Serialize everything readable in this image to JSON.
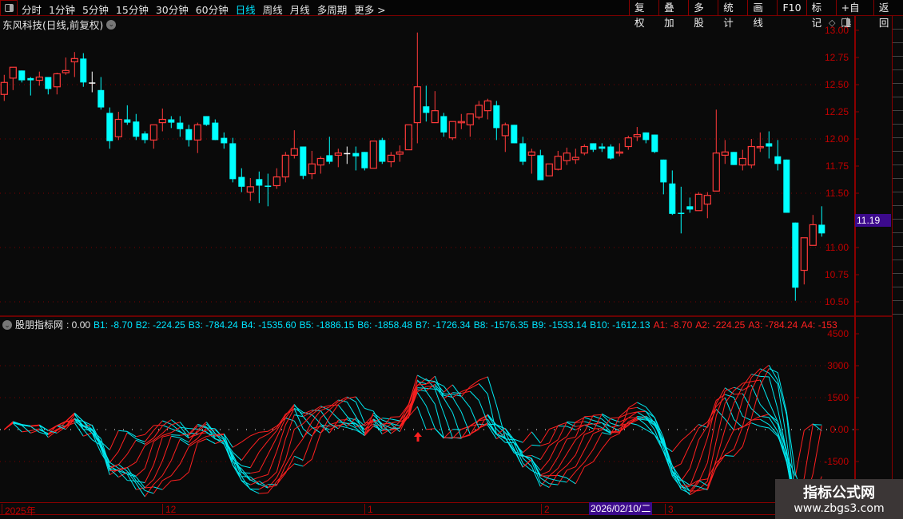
{
  "toolbar": {
    "tabs": [
      "分时",
      "1分钟",
      "5分钟",
      "15分钟",
      "30分钟",
      "60分钟",
      "日线",
      "周线",
      "月线",
      "多周期",
      "更多 >"
    ],
    "active_tab": "日线",
    "buttons": [
      "复权",
      "叠加",
      "多股",
      "统计",
      "画线",
      "F10",
      "标记",
      "+自选",
      "返回"
    ]
  },
  "chart_title": "东风科技(日线,前复权)",
  "colors": {
    "up": "#ff3a3a",
    "down": "#00ffff",
    "doji": "#ffffff",
    "axis": "#c00000",
    "highlight": "#3c0a8c",
    "background": "#0a0a0a"
  },
  "icons": [
    "layout-toggle-icon",
    "chevron-down-icon",
    "diamond-icon",
    "up-arrow-signal-icon"
  ],
  "price_axis": {
    "ticks": [
      "13.00",
      "12.75",
      "12.50",
      "12.25",
      "12.00",
      "11.75",
      "11.50",
      "11.00",
      "10.75",
      "10.50"
    ],
    "ylim": [
      10.45,
      13.05
    ],
    "current_price": "11.19"
  },
  "indicator": {
    "name": "股朋指标网",
    "value": ": 0.00",
    "b_values": [
      "B1: -8.70",
      "B2: -224.25",
      "B3: -784.24",
      "B4: -1535.60",
      "B5: -1886.15",
      "B6: -1858.48",
      "B7: -1726.34",
      "B8: -1576.35",
      "B9: -1533.14",
      "B10: -1612.13"
    ],
    "a_values": [
      "A1: -8.70",
      "A2: -224.25",
      "A3: -784.24",
      "A4: -153"
    ],
    "axis_ticks": [
      "4500",
      "3000",
      "1500",
      "0.00",
      "-1500"
    ],
    "ylim": [
      -2400,
      4700
    ]
  },
  "time_axis": {
    "labels": [
      "2025年",
      "12",
      "1",
      "2",
      "3"
    ],
    "cursor_date": "2026/02/10/二"
  },
  "watermark": {
    "line1": "指标公式网",
    "line2": "www.zbgs3.com"
  },
  "chart_data": {
    "type": "candlestick",
    "fields": [
      "open",
      "high",
      "low",
      "close"
    ],
    "ohlc": [
      [
        12.41,
        12.59,
        12.35,
        12.52
      ],
      [
        12.56,
        12.66,
        12.45,
        12.66
      ],
      [
        12.63,
        12.63,
        12.52,
        12.54
      ],
      [
        12.56,
        12.57,
        12.4,
        12.54
      ],
      [
        12.54,
        12.62,
        12.49,
        12.57
      ],
      [
        12.57,
        12.57,
        12.41,
        12.46
      ],
      [
        12.48,
        12.61,
        12.41,
        12.6
      ],
      [
        12.61,
        12.75,
        12.59,
        12.63
      ],
      [
        12.71,
        12.8,
        12.57,
        12.74
      ],
      [
        12.74,
        12.79,
        12.48,
        12.52
      ],
      [
        12.52,
        12.62,
        12.43,
        12.52
      ],
      [
        12.45,
        12.57,
        12.27,
        12.29
      ],
      [
        12.24,
        12.29,
        11.91,
        11.98
      ],
      [
        12.02,
        12.25,
        11.99,
        12.18
      ],
      [
        12.18,
        12.31,
        12.13,
        12.15
      ],
      [
        12.16,
        12.23,
        11.99,
        12.02
      ],
      [
        12.05,
        12.07,
        11.96,
        11.99
      ],
      [
        11.99,
        12.13,
        11.91,
        12.13
      ],
      [
        12.15,
        12.28,
        12.07,
        12.18
      ],
      [
        12.18,
        12.21,
        12.1,
        12.15
      ],
      [
        12.15,
        12.21,
        12.02,
        12.09
      ],
      [
        12.09,
        12.13,
        11.93,
        11.99
      ],
      [
        11.99,
        12.15,
        11.87,
        12.13
      ],
      [
        12.21,
        12.21,
        12.12,
        12.13
      ],
      [
        12.15,
        12.18,
        11.99,
        11.99
      ],
      [
        12.01,
        12.06,
        11.91,
        11.96
      ],
      [
        11.96,
        12.01,
        11.6,
        11.63
      ],
      [
        11.65,
        11.73,
        11.51,
        11.56
      ],
      [
        11.51,
        11.64,
        11.43,
        11.56
      ],
      [
        11.63,
        11.7,
        11.41,
        11.57
      ],
      [
        11.57,
        11.68,
        11.38,
        11.56
      ],
      [
        11.57,
        11.73,
        11.54,
        11.65
      ],
      [
        11.65,
        11.88,
        11.6,
        11.85
      ],
      [
        11.85,
        12.08,
        11.82,
        11.91
      ],
      [
        11.93,
        11.93,
        11.63,
        11.66
      ],
      [
        11.68,
        11.89,
        11.63,
        11.77
      ],
      [
        11.76,
        11.84,
        11.68,
        11.82
      ],
      [
        11.85,
        12.02,
        11.77,
        11.79
      ],
      [
        11.85,
        11.91,
        11.74,
        11.87
      ],
      [
        11.87,
        11.93,
        11.77,
        11.87
      ],
      [
        11.87,
        11.93,
        11.71,
        11.84
      ],
      [
        11.88,
        11.88,
        11.71,
        11.73
      ],
      [
        11.73,
        11.98,
        11.73,
        11.98
      ],
      [
        11.99,
        12.01,
        11.77,
        11.79
      ],
      [
        11.79,
        11.88,
        11.74,
        11.85
      ],
      [
        11.86,
        11.94,
        11.79,
        11.88
      ],
      [
        11.9,
        12.13,
        11.9,
        12.13
      ],
      [
        12.15,
        12.98,
        11.96,
        12.48
      ],
      [
        12.3,
        12.49,
        12.16,
        12.24
      ],
      [
        12.15,
        12.44,
        12.15,
        12.26
      ],
      [
        12.21,
        12.24,
        12.02,
        12.06
      ],
      [
        12.01,
        12.16,
        11.99,
        12.16
      ],
      [
        12.15,
        12.23,
        12.09,
        12.16
      ],
      [
        12.13,
        12.23,
        12.02,
        12.23
      ],
      [
        12.2,
        12.35,
        12.18,
        12.31
      ],
      [
        12.26,
        12.37,
        12.18,
        12.35
      ],
      [
        12.31,
        12.35,
        11.99,
        12.1
      ],
      [
        12.03,
        12.15,
        11.88,
        12.13
      ],
      [
        12.13,
        12.13,
        11.96,
        11.96
      ],
      [
        11.96,
        12.02,
        11.76,
        11.79
      ],
      [
        11.85,
        11.91,
        11.68,
        11.88
      ],
      [
        11.85,
        11.9,
        11.62,
        11.62
      ],
      [
        11.66,
        11.77,
        11.66,
        11.77
      ],
      [
        11.72,
        11.89,
        11.71,
        11.84
      ],
      [
        11.8,
        11.92,
        11.76,
        11.87
      ],
      [
        11.81,
        11.91,
        11.77,
        11.83
      ],
      [
        11.87,
        11.95,
        11.85,
        11.93
      ],
      [
        11.96,
        11.96,
        11.88,
        11.9
      ],
      [
        11.93,
        11.96,
        11.88,
        11.91
      ],
      [
        11.93,
        11.95,
        11.81,
        11.82
      ],
      [
        11.87,
        11.96,
        11.84,
        11.88
      ],
      [
        11.93,
        12.03,
        11.9,
        12.01
      ],
      [
        12.02,
        12.11,
        11.98,
        12.04
      ],
      [
        12.06,
        12.06,
        11.96,
        11.99
      ],
      [
        12.04,
        12.04,
        11.87,
        11.88
      ],
      [
        11.81,
        11.81,
        11.49,
        11.6
      ],
      [
        11.59,
        11.71,
        11.3,
        11.31
      ],
      [
        11.32,
        11.56,
        11.13,
        11.31
      ],
      [
        11.38,
        11.46,
        11.32,
        11.35
      ],
      [
        11.34,
        11.51,
        11.34,
        11.49
      ],
      [
        11.4,
        11.51,
        11.27,
        11.48
      ],
      [
        11.52,
        12.27,
        11.52,
        11.87
      ],
      [
        11.85,
        11.99,
        11.77,
        11.88
      ],
      [
        11.88,
        11.88,
        11.76,
        11.76
      ],
      [
        11.76,
        11.9,
        11.71,
        11.82
      ],
      [
        11.76,
        12.0,
        11.73,
        11.93
      ],
      [
        11.92,
        12.06,
        11.88,
        11.93
      ],
      [
        11.96,
        12.07,
        11.82,
        11.93
      ],
      [
        11.84,
        11.99,
        11.71,
        11.77
      ],
      [
        11.81,
        11.81,
        11.32,
        11.32
      ],
      [
        11.23,
        11.23,
        10.51,
        10.63
      ],
      [
        10.79,
        11.09,
        10.66,
        11.09
      ],
      [
        11.02,
        11.3,
        11.02,
        11.21
      ],
      [
        11.21,
        11.38,
        11.1,
        11.13
      ]
    ],
    "grid_prices": [
      12.5,
      12.0,
      11.5,
      11.0,
      10.5
    ],
    "indicator_grid": [
      3000,
      1500,
      -1500
    ],
    "indicator_zero_line": 0
  }
}
